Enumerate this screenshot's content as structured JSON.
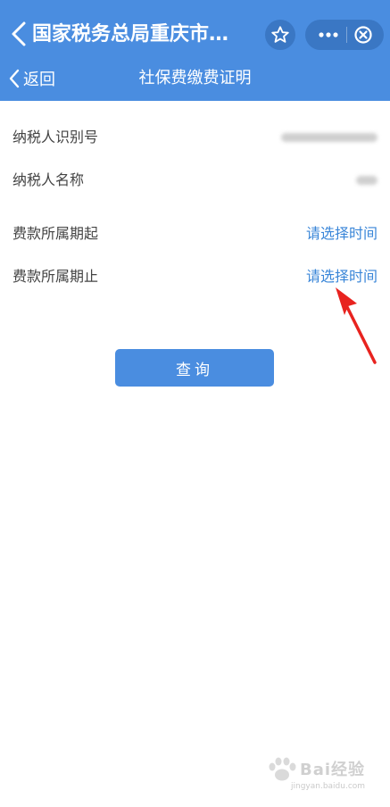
{
  "mini_program": {
    "title": "国家税务总局重庆市…",
    "star_icon": "star-icon",
    "more_icon": "more-dots-icon",
    "close_icon": "close-circle-icon"
  },
  "nav": {
    "back_label": "返回",
    "title": "社保费缴费证明"
  },
  "form": {
    "taxpayer_id_label": "纳税人识别号",
    "taxpayer_name_label": "纳税人名称",
    "period_start_label": "费款所属期起",
    "period_start_value": "请选择时间",
    "period_end_label": "费款所属期止",
    "period_end_value": "请选择时间"
  },
  "actions": {
    "query_label": "查询"
  },
  "watermark": {
    "brand": "Bai经验",
    "url": "jingyan.baidu.com"
  },
  "colors": {
    "header_blue": "#4a8de0",
    "link_blue": "#3a86d8",
    "annotation_red": "#e8231f"
  }
}
